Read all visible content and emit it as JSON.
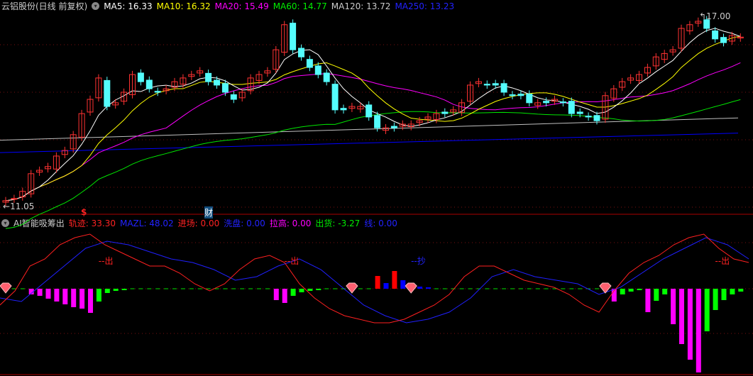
{
  "header": {
    "title": "云铝股份(日线 前复权)",
    "ma5": "MA5: 16.33",
    "ma10": "MA10: 16.32",
    "ma20": "MA20: 15.49",
    "ma60": "MA60: 14.77",
    "ma120": "MA120: 13.72",
    "ma250": "MA250: 13.23"
  },
  "indicator": {
    "title": "AI智能吸筹出",
    "track": "轨迹: 33.30",
    "mazl": "MAZL: 48.02",
    "enter": "进场: 0.00",
    "wash": "洗盘: 0.00",
    "pull": "拉高: 0.00",
    "ship": "出货: -3.27",
    "line": "线: 0.00"
  },
  "markers": {
    "high": "17.00",
    "low": "11.05",
    "dollar": "$",
    "finance": "财",
    "sell": "出",
    "buy": "抄"
  },
  "colors": {
    "up": "#ff3232",
    "down": "#54fcfc",
    "ma5": "#ffffff",
    "ma10": "#ffff00",
    "ma20": "#ff00ff",
    "ma60": "#00e600",
    "ma120": "#c0c0c0",
    "ma250": "#0000ff"
  },
  "chart_data": [
    {
      "type": "candlestick",
      "title": "云铝股份(日线 前复权)",
      "ylim": [
        10.9,
        17.3
      ],
      "closes": [
        11.05,
        11.12,
        11.35,
        11.92,
        12.03,
        12.15,
        12.49,
        12.67,
        13.18,
        13.86,
        14.32,
        15.01,
        14.09,
        14.21,
        14.55,
        15.12,
        14.89,
        14.66,
        14.55,
        14.66,
        14.89,
        15.01,
        15.12,
        15.24,
        14.89,
        14.78,
        14.55,
        14.32,
        14.55,
        15.01,
        15.12,
        15.24,
        15.92,
        16.73,
        15.92,
        15.69,
        15.35,
        15.12,
        14.89,
        13.98,
        13.98,
        14.09,
        14.09,
        13.75,
        13.4,
        13.4,
        13.4,
        13.52,
        13.52,
        13.63,
        13.75,
        13.86,
        13.86,
        13.98,
        14.21,
        14.78,
        14.89,
        14.78,
        14.78,
        14.55,
        14.44,
        14.44,
        14.21,
        14.21,
        14.21,
        14.32,
        14.21,
        13.86,
        13.86,
        13.75,
        13.63,
        14.44,
        14.66,
        14.89,
        15.01,
        15.12,
        15.35,
        15.69,
        15.8,
        15.92,
        16.61,
        16.73,
        16.84,
        16.61,
        16.27,
        16.15,
        16.38,
        16.33
      ],
      "ma120": [
        13.0,
        13.72
      ],
      "ma250": [
        12.6,
        13.23
      ]
    },
    {
      "type": "indicator",
      "track": [
        25,
        45,
        80,
        90,
        110,
        120,
        125,
        110,
        100,
        90,
        80,
        80,
        70,
        55,
        45,
        55,
        75,
        90,
        95,
        85,
        55,
        35,
        20,
        10,
        5,
        0,
        0,
        5,
        15,
        25,
        40,
        65,
        80,
        80,
        70,
        60,
        55,
        50,
        40,
        25,
        15,
        45,
        70,
        85,
        95,
        110,
        120,
        125,
        105,
        90,
        85
      ],
      "mazl": [
        35,
        30,
        55,
        80,
        105,
        115,
        110,
        100,
        90,
        85,
        75,
        60,
        65,
        80,
        90,
        75,
        50,
        25,
        10,
        0,
        5,
        15,
        35,
        65,
        75,
        65,
        60,
        55,
        40,
        50,
        70,
        90,
        105,
        120,
        110,
        90
      ],
      "bars": {
        "3": [
          -8,
          "m"
        ],
        "4": [
          -10,
          "m"
        ],
        "5": [
          -14,
          "m"
        ],
        "6": [
          -18,
          "m"
        ],
        "7": [
          -22,
          "m"
        ],
        "8": [
          -26,
          "m"
        ],
        "9": [
          -28,
          "m"
        ],
        "10": [
          -34,
          "m"
        ],
        "11": [
          -18,
          "g"
        ],
        "12": [
          -6,
          "g"
        ],
        "13": [
          -3,
          "g"
        ],
        "14": [
          -2,
          "g"
        ],
        "32": [
          -16,
          "m"
        ],
        "33": [
          -20,
          "m"
        ],
        "34": [
          -10,
          "g"
        ],
        "35": [
          -5,
          "g"
        ],
        "36": [
          -3,
          "g"
        ],
        "37": [
          -2,
          "g"
        ],
        "44": [
          18,
          "r"
        ],
        "45": [
          8,
          "b"
        ],
        "46": [
          25,
          "r"
        ],
        "47": [
          12,
          "b"
        ],
        "48": [
          5,
          "b"
        ],
        "49": [
          3,
          "b"
        ],
        "50": [
          2,
          "b"
        ],
        "72": [
          -18,
          "m"
        ],
        "73": [
          -8,
          "g"
        ],
        "74": [
          -4,
          "g"
        ],
        "75": [
          -2,
          "g"
        ],
        "76": [
          -33,
          "m"
        ],
        "77": [
          -17,
          "g"
        ],
        "78": [
          -8,
          "g"
        ],
        "79": [
          -50,
          "m"
        ],
        "80": [
          -78,
          "m"
        ],
        "81": [
          -100,
          "m"
        ],
        "82": [
          -118,
          "m"
        ],
        "83": [
          -60,
          "g"
        ],
        "84": [
          -30,
          "g"
        ],
        "85": [
          -16,
          "g"
        ],
        "86": [
          -8,
          "g"
        ],
        "87": [
          -4,
          "g"
        ]
      },
      "diamonds": [
        0,
        41,
        48,
        71
      ],
      "sells": [
        12,
        34,
        85
      ],
      "buys": [
        49
      ]
    }
  ]
}
